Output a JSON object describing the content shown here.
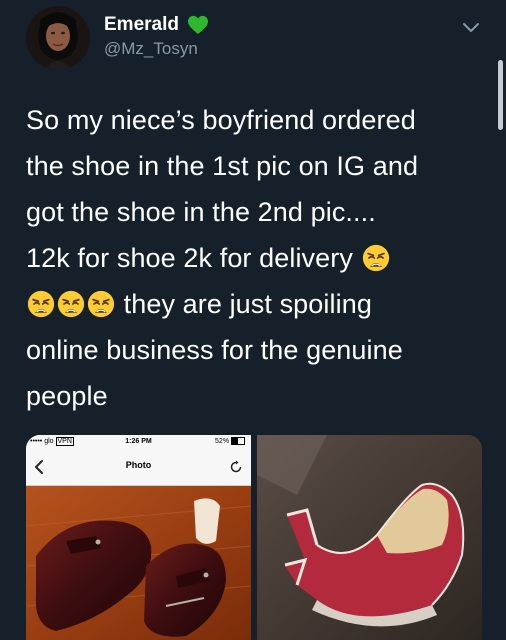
{
  "user": {
    "display_name": "Emerald",
    "handle": "@Mz_Tosyn",
    "badge_icon": "green-heart-icon",
    "badge_color": "#2eb82e"
  },
  "tweet": {
    "lines": [
      "So my niece’s boyfriend ordered",
      "the shoe in the 1st pic on IG and",
      "got the shoe in the 2nd pic....",
      "12k for shoe 2k for delivery",
      "they are just spoiling",
      "online business for the genuine",
      "people"
    ],
    "emoji": "weary-face-emoji"
  },
  "media": {
    "left_phone": {
      "carrier": "••••• glo",
      "network": "VPN",
      "time": "1:26 PM",
      "battery": "52%",
      "title": "Photo"
    }
  },
  "colors": {
    "background": "#15202b",
    "secondary_text": "#8899a6"
  }
}
